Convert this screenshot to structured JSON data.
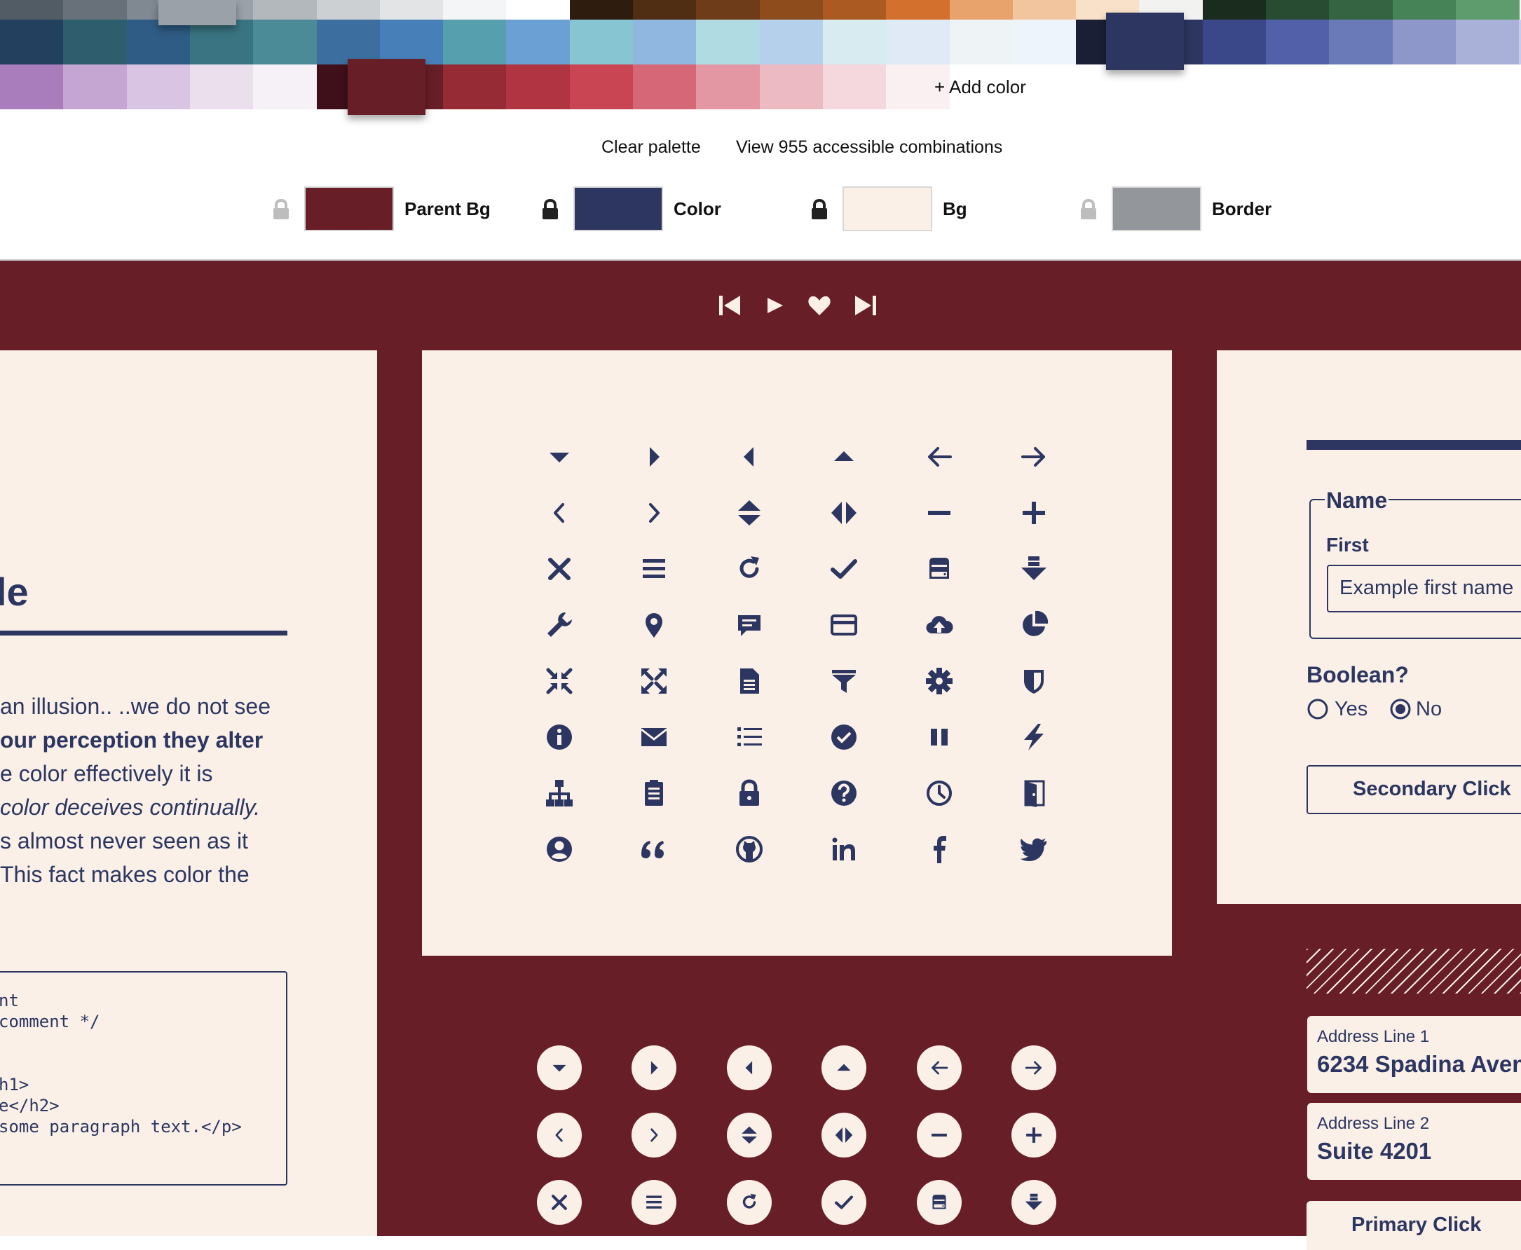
{
  "palette": {
    "row1": [
      "#525c65",
      "#68717a",
      "#808892",
      "#9aa1a8",
      "#b3b8bc",
      "#cdd0d3",
      "#e2e4e6",
      "#f4f5f6",
      "#ffffff",
      "#2e1d0e",
      "#4f2e14",
      "#6e3c18",
      "#8e4c1d",
      "#ab5a22",
      "#d4702e",
      "#e8a36c",
      "#f2c59e",
      "#f8e1c8",
      "#f2f2f0",
      "#1a2c1d",
      "#284c31",
      "#356442",
      "#468458",
      "#5e9c6e"
    ],
    "row2": [
      "#23405f",
      "#2e5e6d",
      "#2f5c84",
      "#3a7482",
      "#4a8b97",
      "#3c6f9f",
      "#4780b8",
      "#569faf",
      "#6aa0d3",
      "#87c5d3",
      "#8fb7e0",
      "#b1dbe3",
      "#b5d0eb",
      "#d7ebf0",
      "#dfeaf6",
      "#eef4f6",
      "#eef4fb",
      "#1a1f36",
      "#2c3660",
      "#3a4789",
      "#5160a8",
      "#6a79b8",
      "#8d97c9",
      "#aab1d8",
      "#c8cce6"
    ],
    "row3": [
      "#a97cbb",
      "#c5a6d3",
      "#d9c5e3",
      "#ebdfee",
      "#f6f0f7",
      "#3f101a",
      "#671e26",
      "#962a35",
      "#b13442",
      "#c94553",
      "#d56777",
      "#e297a3",
      "#ebbac3",
      "#f4d8dd",
      "#faf0f1"
    ],
    "add_color": "+ Add color",
    "raised": {
      "top": "#9aa1a8",
      "blue": "#2c3660",
      "red": "#671e26"
    }
  },
  "actions": {
    "clear": "Clear palette",
    "view": "View 955 accessible combinations"
  },
  "roles": [
    {
      "label": "Parent Bg",
      "color": "#671e26",
      "locked": false
    },
    {
      "label": "Color",
      "color": "#2c3660",
      "locked": true
    },
    {
      "label": "Bg",
      "color": "#faf0e8",
      "locked": true
    },
    {
      "label": "Border",
      "color": "#93969a",
      "locked": false
    }
  ],
  "theme": {
    "parent_bg": "#671e26",
    "color": "#2c3660",
    "bg": "#faf0e8",
    "border": "#93969a"
  },
  "player_icons": [
    "skip-back-icon",
    "play-icon",
    "heart-icon",
    "skip-forward-icon"
  ],
  "icon_grid": [
    [
      "caret-down-icon",
      "caret-right-icon",
      "caret-left-icon",
      "caret-up-icon",
      "arrow-left-icon",
      "arrow-right-icon"
    ],
    [
      "chevron-left-icon",
      "chevron-right-icon",
      "sort-vertical-icon",
      "sort-horizontal-icon",
      "minus-icon",
      "plus-icon"
    ],
    [
      "close-icon",
      "menu-icon",
      "refresh-icon",
      "check-icon",
      "hard-drive-icon",
      "download-icon"
    ],
    [
      "wrench-icon",
      "map-pin-icon",
      "chat-icon",
      "credit-card-icon",
      "cloud-upload-icon",
      "pie-chart-icon"
    ],
    [
      "compress-icon",
      "expand-icon",
      "document-icon",
      "filter-icon",
      "gear-icon",
      "shield-icon"
    ],
    [
      "info-icon",
      "mail-icon",
      "list-icon",
      "check-circle-icon",
      "pause-icon",
      "lightning-icon"
    ],
    [
      "sitemap-icon",
      "clipboard-icon",
      "lock-icon",
      "help-icon",
      "clock-icon",
      "door-exit-icon"
    ],
    [
      "user-circle-icon",
      "quote-icon",
      "github-icon",
      "linkedin-icon",
      "facebook-icon",
      "twitter-icon"
    ]
  ],
  "circle_icons": [
    [
      "caret-down-icon",
      "caret-right-icon",
      "caret-left-icon",
      "caret-up-icon",
      "arrow-left-icon",
      "arrow-right-icon"
    ],
    [
      "chevron-left-icon",
      "chevron-right-icon",
      "sort-vertical-icon",
      "sort-horizontal-icon",
      "minus-icon",
      "plus-icon"
    ],
    [
      "close-icon",
      "menu-icon",
      "refresh-icon",
      "check-icon",
      "hard-drive-icon",
      "download-icon"
    ]
  ],
  "left_card": {
    "heading_fragment": "le",
    "lines": [
      {
        "text": "an illusion.. ..we do not see",
        "style": "normal"
      },
      {
        "text": "our perception they alter",
        "style": "bold"
      },
      {
        "text": "e color effectively it is",
        "style": "normal"
      },
      {
        "text": " color deceives continually.",
        "style": "italic"
      },
      {
        "text": "s almost never seen as it",
        "style": "normal"
      },
      {
        "text": " This fact makes color the",
        "style": "normal"
      }
    ],
    "code_lines": [
      "nt",
      " comment */",
      "",
      "",
      "h1>",
      "e</h2>",
      "some paragraph text.</p>"
    ]
  },
  "form": {
    "legend": "Name",
    "first_label": "First",
    "first_placeholder": "Example first name",
    "boolean_label": "Boolean?",
    "yes": "Yes",
    "no": "No",
    "secondary": "Secondary Click",
    "address1_label": "Address Line 1",
    "address1_value": "6234 Spadina Aven",
    "address2_label": "Address Line 2",
    "address2_value": "Suite 4201",
    "primary": "Primary Click"
  }
}
